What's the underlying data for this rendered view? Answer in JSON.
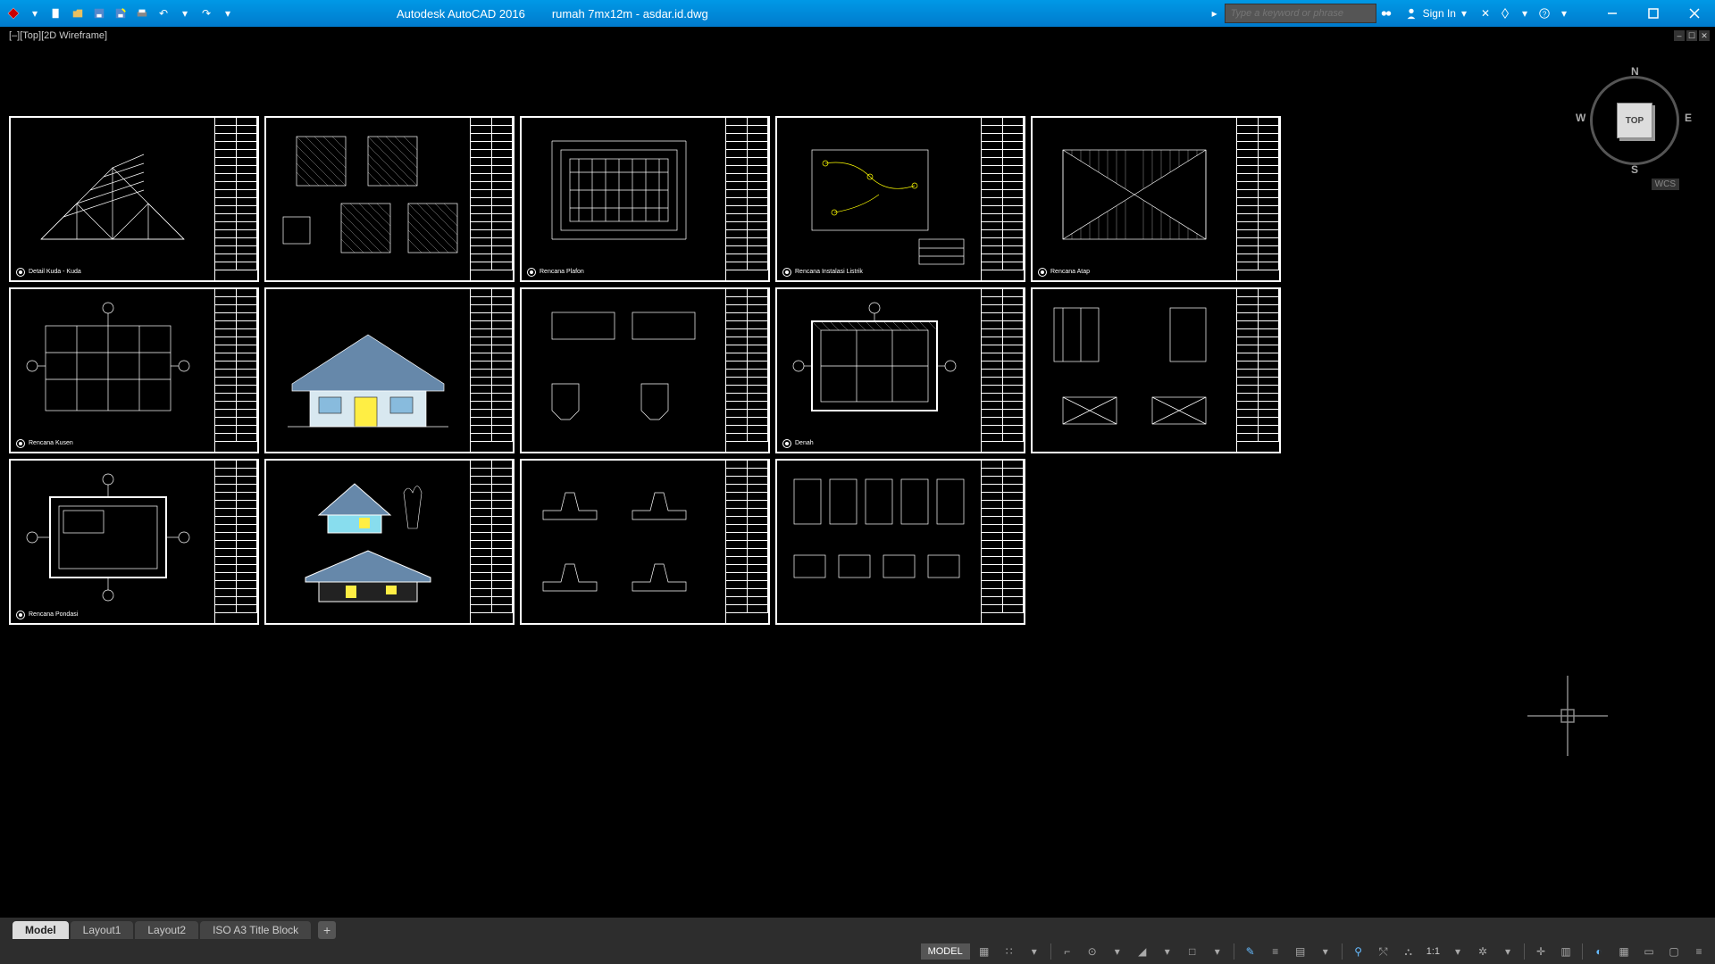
{
  "titlebar": {
    "app_title": "Autodesk AutoCAD 2016",
    "file_title": "rumah 7mx12m - asdar.id.dwg",
    "search_placeholder": "Type a keyword or phrase",
    "signin_label": "Sign In"
  },
  "viewport": {
    "label": "[–][Top][2D Wireframe]",
    "viewcube_face": "TOP",
    "wcs_label": "WCS",
    "compass": {
      "n": "N",
      "e": "E",
      "s": "S",
      "w": "W"
    }
  },
  "sheets": [
    {
      "caption": "Detail Kuda - Kuda"
    },
    {
      "caption": ""
    },
    {
      "caption": "Rencana Plafon"
    },
    {
      "caption": "Rencana Instalasi Listrik"
    },
    {
      "caption": "Rencana Atap"
    },
    {
      "caption": "Rencana Kusen"
    },
    {
      "caption": ""
    },
    {
      "caption": ""
    },
    {
      "caption": "Denah"
    },
    {
      "caption": ""
    },
    {
      "caption": "Rencana Pondasi"
    },
    {
      "caption": ""
    },
    {
      "caption": ""
    },
    {
      "caption": ""
    },
    {
      "caption": ""
    }
  ],
  "tabs": {
    "items": [
      {
        "label": "Model",
        "active": true
      },
      {
        "label": "Layout1",
        "active": false
      },
      {
        "label": "Layout2",
        "active": false
      },
      {
        "label": "ISO A3 Title Block",
        "active": false
      }
    ]
  },
  "statusbar": {
    "model_label": "MODEL",
    "scale_label": "1:1"
  }
}
